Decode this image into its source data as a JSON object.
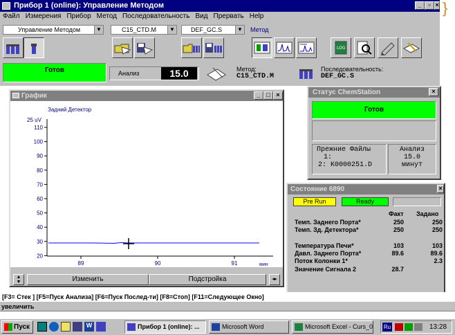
{
  "window": {
    "title": "Прибор 1 (online): Управление Методом"
  },
  "menu": [
    "Файл",
    "Измерения",
    "Прибор",
    "Метод",
    "Последовательность",
    "Вид",
    "Прервать",
    "Help"
  ],
  "toolbar": {
    "view_select": "Управление Методом",
    "method_select": "C15_CTD.M",
    "sequence_select": "DEF_GC.S",
    "method_label": "Метод"
  },
  "status": {
    "state": "Готов",
    "analysis_label": "Анализ",
    "analysis_value": "15.0",
    "method_label": "Метод:",
    "method_value": "C15_CTD.M",
    "sequence_label": "Последовательность:",
    "sequence_value": "DEF_GC.S"
  },
  "graph": {
    "title": "График",
    "detector_label": "Задний Детектор",
    "y_unit": "25 uV",
    "y_ticks": [
      "110",
      "100",
      "90",
      "80",
      "70",
      "60",
      "50",
      "40",
      "30",
      "20"
    ],
    "x_ticks": [
      "89",
      "90",
      "91"
    ],
    "x_unit": "мин",
    "btn_change": "Изменить",
    "btn_adjust": "Подстройка"
  },
  "chemstation": {
    "title": "Статус ChemStation",
    "state": "Готов",
    "prev_files_label": "Прежние Файлы",
    "file1": "1:",
    "file2": "2: K0000251.D",
    "analysis_label": "Анализ",
    "analysis_value": "15.0",
    "analysis_unit": "минут"
  },
  "gc": {
    "title": "Состояние 6890",
    "prerun": "Pre Run",
    "ready": "Ready",
    "col_fact": "Факт",
    "col_set": "Задано",
    "rows": [
      {
        "label": "Темп. Заднего Порта*",
        "fact": "250",
        "set": "250"
      },
      {
        "label": "Темп. Зд. Детектора*",
        "fact": "250",
        "set": "250"
      },
      {
        "label": "Температура Печи*",
        "fact": "103",
        "set": "103"
      },
      {
        "label": "Давл. Заднего Порта*",
        "fact": "89.6",
        "set": "89.6"
      },
      {
        "label": "Поток Колонки 1*",
        "fact": "",
        "set": "2.3"
      },
      {
        "label": "Значение Сигнала 2",
        "fact": "28.7",
        "set": ""
      }
    ]
  },
  "fkeys": "[F3= Стек ]  [F5=Пуск Анализа]  [F6=Пуск Послед-ти]  [F8=Стоп]  [F11=Следующее Окно]",
  "hint": "увеличить",
  "taskbar": {
    "start": "Пуск",
    "items": [
      "Прибор 1 (online): ...",
      "Microsoft Word",
      "Microsoft Excel - Curs_0..."
    ],
    "time": "13:28"
  },
  "colors": {
    "green": "#00ff00",
    "yellow": "#ffff00",
    "navy": "#000080",
    "trace": "#0000ff"
  }
}
